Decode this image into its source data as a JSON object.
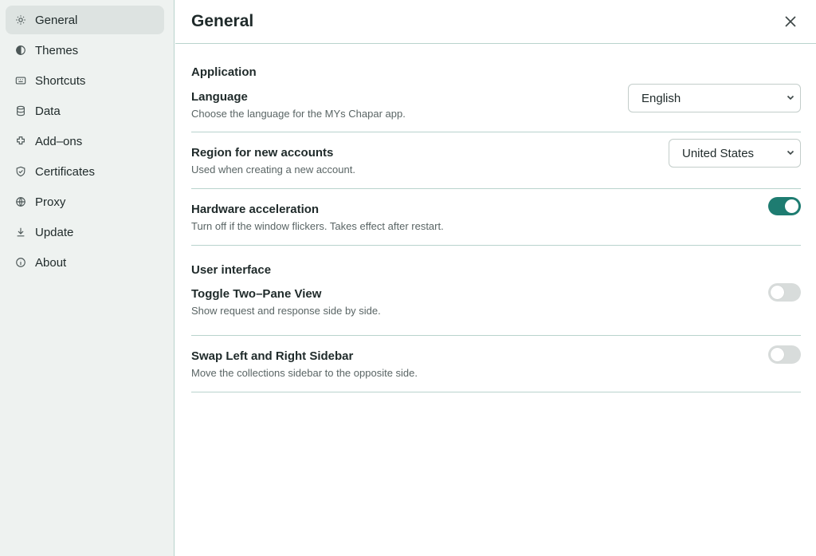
{
  "sidebar": {
    "items": [
      {
        "label": "General",
        "icon": "sun-icon",
        "active": true
      },
      {
        "label": "Themes",
        "icon": "half-circle-icon"
      },
      {
        "label": "Shortcuts",
        "icon": "keyboard-icon"
      },
      {
        "label": "Data",
        "icon": "database-icon"
      },
      {
        "label": "Add–ons",
        "icon": "puzzle-icon"
      },
      {
        "label": "Certificates",
        "icon": "shield-check-icon"
      },
      {
        "label": "Proxy",
        "icon": "globe-icon"
      },
      {
        "label": "Update",
        "icon": "download-icon"
      },
      {
        "label": "About",
        "icon": "info-icon"
      }
    ]
  },
  "header": {
    "title": "General"
  },
  "application": {
    "title": "Application",
    "language": {
      "label": "Language",
      "description": "Choose the language for the MYs Chapar app.",
      "value": "English"
    },
    "region": {
      "label": "Region for new accounts",
      "description": "Used when creating a new account.",
      "value": "United States"
    },
    "hardware": {
      "label": "Hardware acceleration",
      "description": "Turn off if the window flickers. Takes effect after restart.",
      "enabled": true
    }
  },
  "ui": {
    "title": "User interface",
    "two_pane": {
      "label": "Toggle Two–Pane View",
      "description": "Show request and response side by side.",
      "enabled": false
    },
    "swap_sidebar": {
      "label": "Swap Left and Right Sidebar",
      "description": "Move the collections sidebar to the opposite side.",
      "enabled": false
    }
  },
  "colors": {
    "accent": "#1e7c71",
    "border": "#b9d3cd",
    "sidebar_bg": "#eef2f0"
  }
}
